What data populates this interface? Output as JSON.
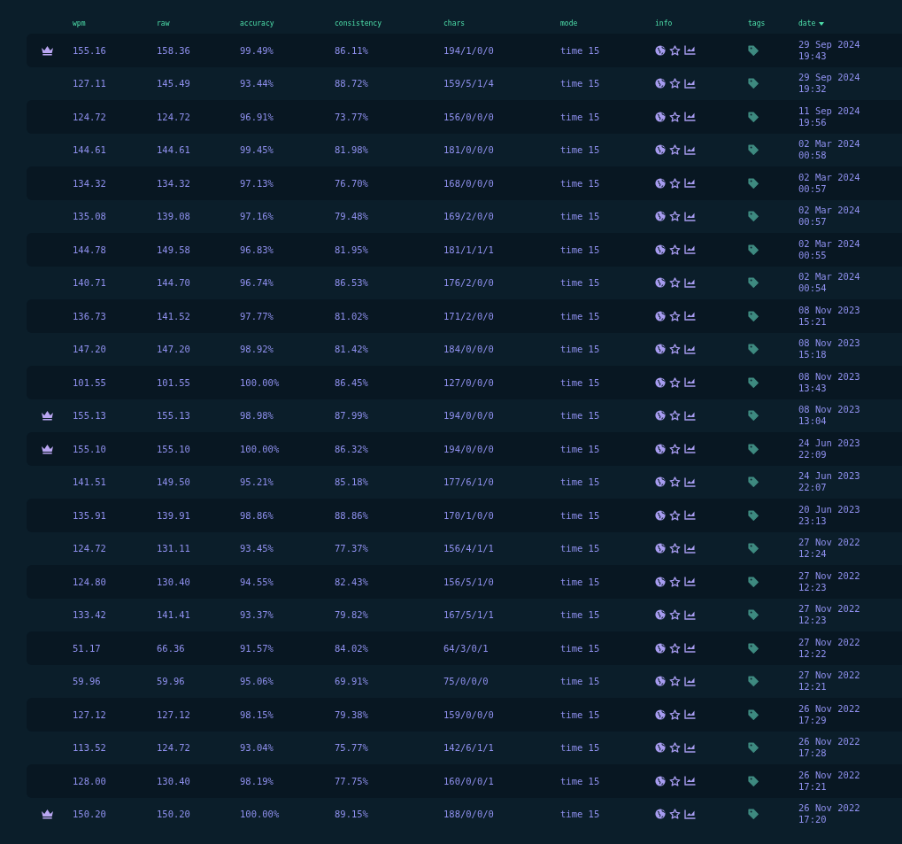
{
  "table": {
    "columns": [
      {
        "label": "wpm",
        "sorted_descending": false
      },
      {
        "label": "raw",
        "sorted_descending": false
      },
      {
        "label": "accuracy",
        "sorted_descending": false
      },
      {
        "label": "consistency",
        "sorted_descending": false
      },
      {
        "label": "chars",
        "sorted_descending": false
      },
      {
        "label": "mode",
        "sorted_descending": false
      },
      {
        "label": "info",
        "sorted_descending": false
      },
      {
        "label": "tags",
        "sorted_descending": false
      },
      {
        "label": "date",
        "sorted_descending": true
      }
    ],
    "rows": [
      {
        "pb": true,
        "wpm": "155.16",
        "raw": "158.36",
        "accuracy": "99.49%",
        "consistency": "86.11%",
        "chars": "194/1/0/0",
        "mode": "time 15",
        "date": "29 Sep 2024",
        "time": "19:43"
      },
      {
        "pb": false,
        "wpm": "127.11",
        "raw": "145.49",
        "accuracy": "93.44%",
        "consistency": "88.72%",
        "chars": "159/5/1/4",
        "mode": "time 15",
        "date": "29 Sep 2024",
        "time": "19:32"
      },
      {
        "pb": false,
        "wpm": "124.72",
        "raw": "124.72",
        "accuracy": "96.91%",
        "consistency": "73.77%",
        "chars": "156/0/0/0",
        "mode": "time 15",
        "date": "11 Sep 2024",
        "time": "19:56"
      },
      {
        "pb": false,
        "wpm": "144.61",
        "raw": "144.61",
        "accuracy": "99.45%",
        "consistency": "81.98%",
        "chars": "181/0/0/0",
        "mode": "time 15",
        "date": "02 Mar 2024",
        "time": "00:58"
      },
      {
        "pb": false,
        "wpm": "134.32",
        "raw": "134.32",
        "accuracy": "97.13%",
        "consistency": "76.70%",
        "chars": "168/0/0/0",
        "mode": "time 15",
        "date": "02 Mar 2024",
        "time": "00:57"
      },
      {
        "pb": false,
        "wpm": "135.08",
        "raw": "139.08",
        "accuracy": "97.16%",
        "consistency": "79.48%",
        "chars": "169/2/0/0",
        "mode": "time 15",
        "date": "02 Mar 2024",
        "time": "00:57"
      },
      {
        "pb": false,
        "wpm": "144.78",
        "raw": "149.58",
        "accuracy": "96.83%",
        "consistency": "81.95%",
        "chars": "181/1/1/1",
        "mode": "time 15",
        "date": "02 Mar 2024",
        "time": "00:55"
      },
      {
        "pb": false,
        "wpm": "140.71",
        "raw": "144.70",
        "accuracy": "96.74%",
        "consistency": "86.53%",
        "chars": "176/2/0/0",
        "mode": "time 15",
        "date": "02 Mar 2024",
        "time": "00:54"
      },
      {
        "pb": false,
        "wpm": "136.73",
        "raw": "141.52",
        "accuracy": "97.77%",
        "consistency": "81.02%",
        "chars": "171/2/0/0",
        "mode": "time 15",
        "date": "08 Nov 2023",
        "time": "15:21"
      },
      {
        "pb": false,
        "wpm": "147.20",
        "raw": "147.20",
        "accuracy": "98.92%",
        "consistency": "81.42%",
        "chars": "184/0/0/0",
        "mode": "time 15",
        "date": "08 Nov 2023",
        "time": "15:18"
      },
      {
        "pb": false,
        "wpm": "101.55",
        "raw": "101.55",
        "accuracy": "100.00%",
        "consistency": "86.45%",
        "chars": "127/0/0/0",
        "mode": "time 15",
        "date": "08 Nov 2023",
        "time": "13:43"
      },
      {
        "pb": true,
        "wpm": "155.13",
        "raw": "155.13",
        "accuracy": "98.98%",
        "consistency": "87.99%",
        "chars": "194/0/0/0",
        "mode": "time 15",
        "date": "08 Nov 2023",
        "time": "13:04"
      },
      {
        "pb": true,
        "wpm": "155.10",
        "raw": "155.10",
        "accuracy": "100.00%",
        "consistency": "86.32%",
        "chars": "194/0/0/0",
        "mode": "time 15",
        "date": "24 Jun 2023",
        "time": "22:09"
      },
      {
        "pb": false,
        "wpm": "141.51",
        "raw": "149.50",
        "accuracy": "95.21%",
        "consistency": "85.18%",
        "chars": "177/6/1/0",
        "mode": "time 15",
        "date": "24 Jun 2023",
        "time": "22:07"
      },
      {
        "pb": false,
        "wpm": "135.91",
        "raw": "139.91",
        "accuracy": "98.86%",
        "consistency": "88.86%",
        "chars": "170/1/0/0",
        "mode": "time 15",
        "date": "20 Jun 2023",
        "time": "23:13"
      },
      {
        "pb": false,
        "wpm": "124.72",
        "raw": "131.11",
        "accuracy": "93.45%",
        "consistency": "77.37%",
        "chars": "156/4/1/1",
        "mode": "time 15",
        "date": "27 Nov 2022",
        "time": "12:24"
      },
      {
        "pb": false,
        "wpm": "124.80",
        "raw": "130.40",
        "accuracy": "94.55%",
        "consistency": "82.43%",
        "chars": "156/5/1/0",
        "mode": "time 15",
        "date": "27 Nov 2022",
        "time": "12:23"
      },
      {
        "pb": false,
        "wpm": "133.42",
        "raw": "141.41",
        "accuracy": "93.37%",
        "consistency": "79.82%",
        "chars": "167/5/1/1",
        "mode": "time 15",
        "date": "27 Nov 2022",
        "time": "12:23"
      },
      {
        "pb": false,
        "wpm": "51.17",
        "raw": "66.36",
        "accuracy": "91.57%",
        "consistency": "84.02%",
        "chars": "64/3/0/1",
        "mode": "time 15",
        "date": "27 Nov 2022",
        "time": "12:22"
      },
      {
        "pb": false,
        "wpm": "59.96",
        "raw": "59.96",
        "accuracy": "95.06%",
        "consistency": "69.91%",
        "chars": "75/0/0/0",
        "mode": "time 15",
        "date": "27 Nov 2022",
        "time": "12:21"
      },
      {
        "pb": false,
        "wpm": "127.12",
        "raw": "127.12",
        "accuracy": "98.15%",
        "consistency": "79.38%",
        "chars": "159/0/0/0",
        "mode": "time 15",
        "date": "26 Nov 2022",
        "time": "17:29"
      },
      {
        "pb": false,
        "wpm": "113.52",
        "raw": "124.72",
        "accuracy": "93.04%",
        "consistency": "75.77%",
        "chars": "142/6/1/1",
        "mode": "time 15",
        "date": "26 Nov 2022",
        "time": "17:28"
      },
      {
        "pb": false,
        "wpm": "128.00",
        "raw": "130.40",
        "accuracy": "98.19%",
        "consistency": "77.75%",
        "chars": "160/0/0/1",
        "mode": "time 15",
        "date": "26 Nov 2022",
        "time": "17:21"
      },
      {
        "pb": true,
        "wpm": "150.20",
        "raw": "150.20",
        "accuracy": "100.00%",
        "consistency": "89.15%",
        "chars": "188/0/0/0",
        "mode": "time 15",
        "date": "26 Nov 2022",
        "time": "17:20"
      }
    ]
  }
}
